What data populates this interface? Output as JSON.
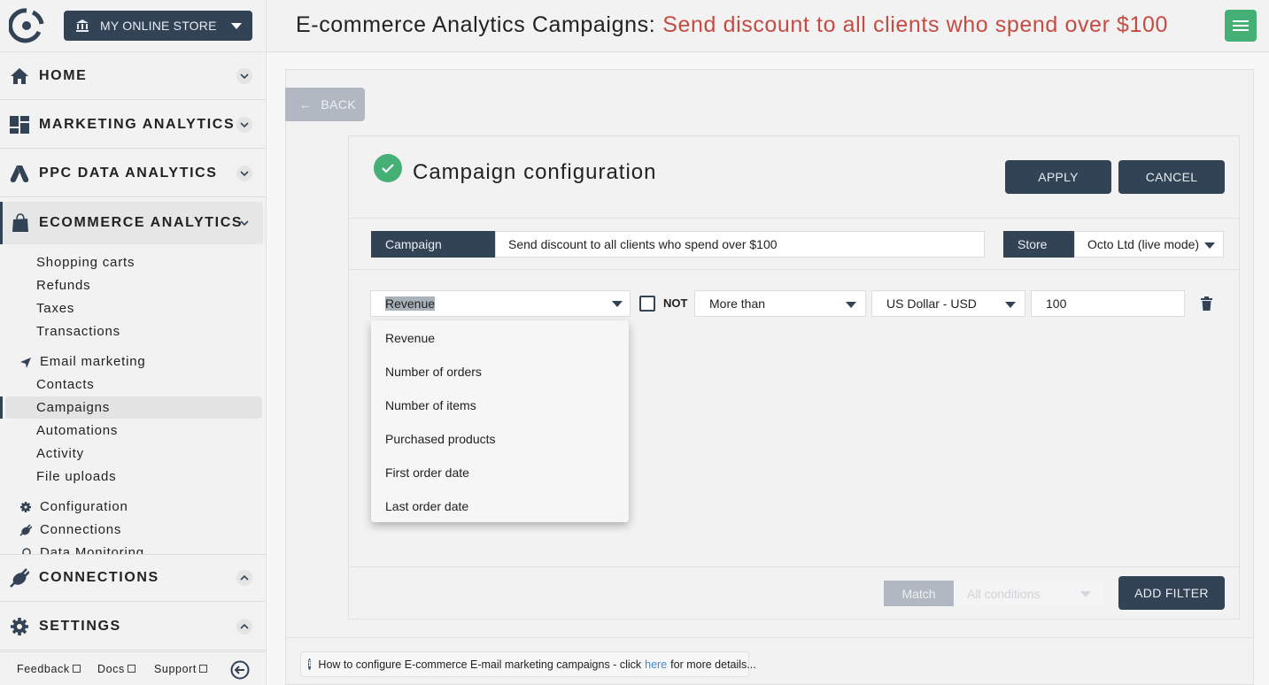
{
  "sidebar": {
    "store_button_label": "MY ONLINE STORE",
    "sections": [
      {
        "label": "HOME",
        "icon": "home-icon",
        "expanded": false
      },
      {
        "label": "MARKETING ANALYTICS",
        "icon": "dashboard-icon",
        "expanded": false
      },
      {
        "label": "PPC DATA ANALYTICS",
        "icon": "google-ads-icon",
        "expanded": false
      },
      {
        "label": "ECOMMERCE ANALYTICS",
        "icon": "shopping-bag-icon",
        "expanded": true
      }
    ],
    "ecommerce_items": [
      "Shopping carts",
      "Refunds",
      "Taxes",
      "Transactions"
    ],
    "email_marketing": {
      "label": "Email marketing",
      "items": [
        "Contacts",
        "Campaigns",
        "Automations",
        "Activity",
        "File uploads"
      ],
      "active": "Campaigns"
    },
    "extra_items": [
      {
        "label": "Configuration",
        "icon": "gear-icon"
      },
      {
        "label": "Connections",
        "icon": "plug-icon"
      },
      {
        "label": "Data Monitoring",
        "icon": "search-icon"
      }
    ],
    "bottom_sections": [
      {
        "label": "CONNECTIONS",
        "icon": "plug-icon"
      },
      {
        "label": "SETTINGS",
        "icon": "gear-icon"
      }
    ],
    "footer_links": [
      "Feedback",
      "Docs",
      "Support"
    ]
  },
  "header": {
    "title_prefix": "E-commerce Analytics Campaigns:",
    "title_highlight": "Send discount to all clients who spend over $100"
  },
  "page": {
    "back_label": "BACK",
    "card_title": "Campaign configuration",
    "apply_label": "APPLY",
    "cancel_label": "CANCEL",
    "campaign_label": "Campaign",
    "campaign_value": "Send discount to all clients who spend over $100",
    "store_label": "Store",
    "store_value": "Octo Ltd (live mode)",
    "filter": {
      "field": "Revenue",
      "not_label": "NOT",
      "not_checked": false,
      "operator": "More than",
      "currency": "US Dollar - USD",
      "value": "100"
    },
    "field_options": [
      "Revenue",
      "Number of orders",
      "Number of items",
      "Purchased products",
      "First order date",
      "Last order date"
    ],
    "match_label": "Match",
    "match_value": "All conditions",
    "add_filter_label": "ADD FILTER",
    "help": {
      "text_before": "How to configure E-commerce E-mail marketing campaigns - click",
      "link_text": "here",
      "text_after": "for more details..."
    }
  },
  "colors": {
    "primary_dark": "#334356",
    "accent_green": "#45b076",
    "title_red": "#c64b43",
    "link_blue": "#3a8dd6"
  }
}
